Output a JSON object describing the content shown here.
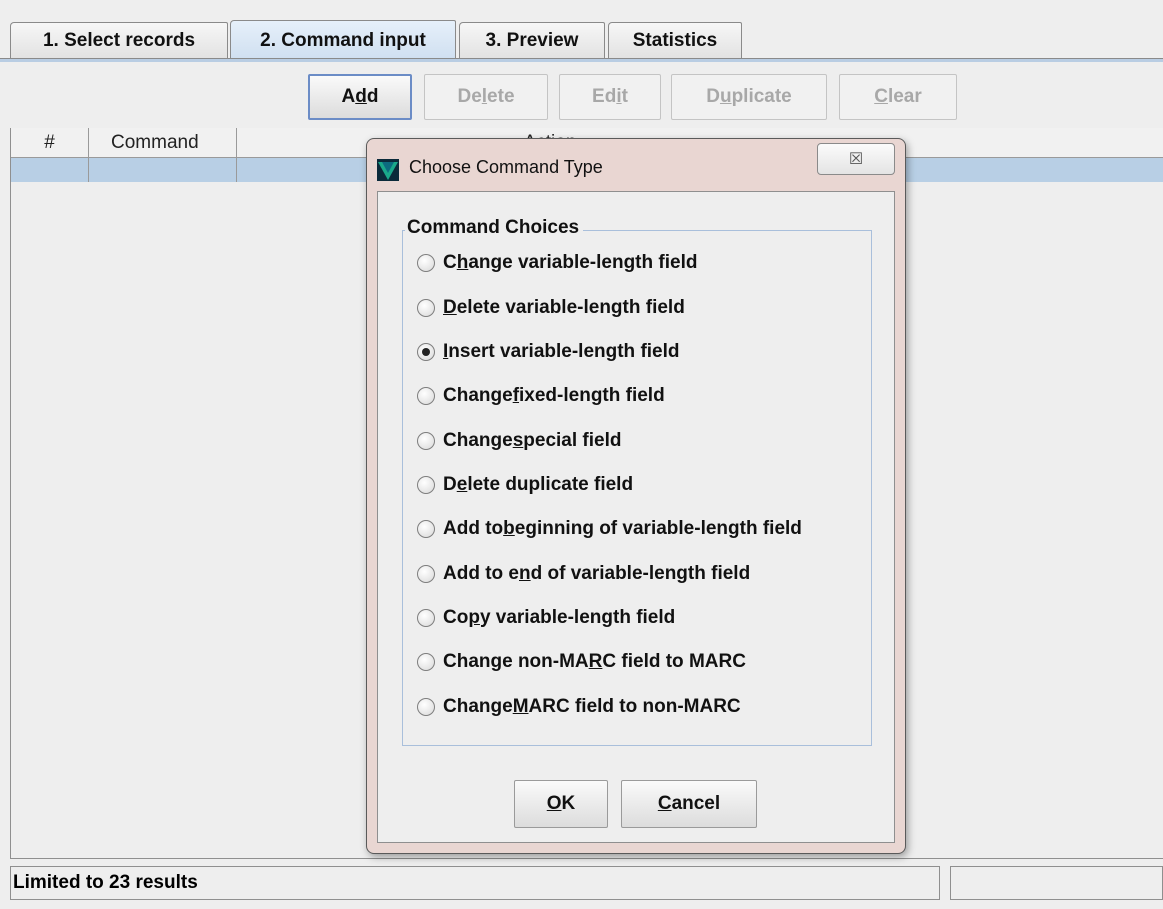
{
  "tabs": [
    {
      "label": "1. Select records"
    },
    {
      "label": "2. Command input"
    },
    {
      "label": "3. Preview"
    },
    {
      "label": "Statistics"
    }
  ],
  "toolbar": {
    "add": {
      "pre": "A",
      "u": "d",
      "post": "d"
    },
    "delete": {
      "pre": "De",
      "u": "l",
      "post": "ete"
    },
    "edit": {
      "pre": "Ed",
      "u": "i",
      "post": "t"
    },
    "duplicate": {
      "pre": "D",
      "u": "u",
      "post": "plicate"
    },
    "clear": {
      "pre": "",
      "u": "C",
      "post": "lear"
    }
  },
  "table": {
    "columns": [
      "#",
      "Command",
      "Action"
    ]
  },
  "dialog": {
    "title": "Choose Command Type",
    "close_glyph": "☒",
    "group_label": "Command Choices",
    "options": [
      {
        "pre": "C",
        "u": "h",
        "post": "ange variable-length field",
        "selected": false
      },
      {
        "pre": "",
        "u": "D",
        "post": "elete variable-length field",
        "selected": false
      },
      {
        "pre": "",
        "u": "I",
        "post": "nsert variable-length field",
        "selected": true
      },
      {
        "pre": "Change ",
        "u": "f",
        "post": "ixed-length field",
        "selected": false
      },
      {
        "pre": "Change ",
        "u": "s",
        "post": "pecial field",
        "selected": false
      },
      {
        "pre": "D",
        "u": "e",
        "post": "lete duplicate field",
        "selected": false
      },
      {
        "pre": "Add to ",
        "u": "b",
        "post": "eginning of variable-length field",
        "selected": false
      },
      {
        "pre": "Add to e",
        "u": "n",
        "post": "d of variable-length field",
        "selected": false
      },
      {
        "pre": "Co",
        "u": "p",
        "post": "y variable-length field",
        "selected": false
      },
      {
        "pre": "Change non-MA",
        "u": "R",
        "post": "C field to MARC",
        "selected": false
      },
      {
        "pre": "Change ",
        "u": "M",
        "post": "ARC field to non-MARC",
        "selected": false
      }
    ],
    "ok": {
      "pre": "",
      "u": "O",
      "post": "K"
    },
    "cancel": {
      "pre": "",
      "u": "C",
      "post": "ancel"
    }
  },
  "status": {
    "left_text": "Limited to 23 results"
  },
  "colors": {
    "selection_row": "#b8cfe5",
    "dialog_frame": "#e9d6d2",
    "active_tab": "#cfdff0"
  }
}
